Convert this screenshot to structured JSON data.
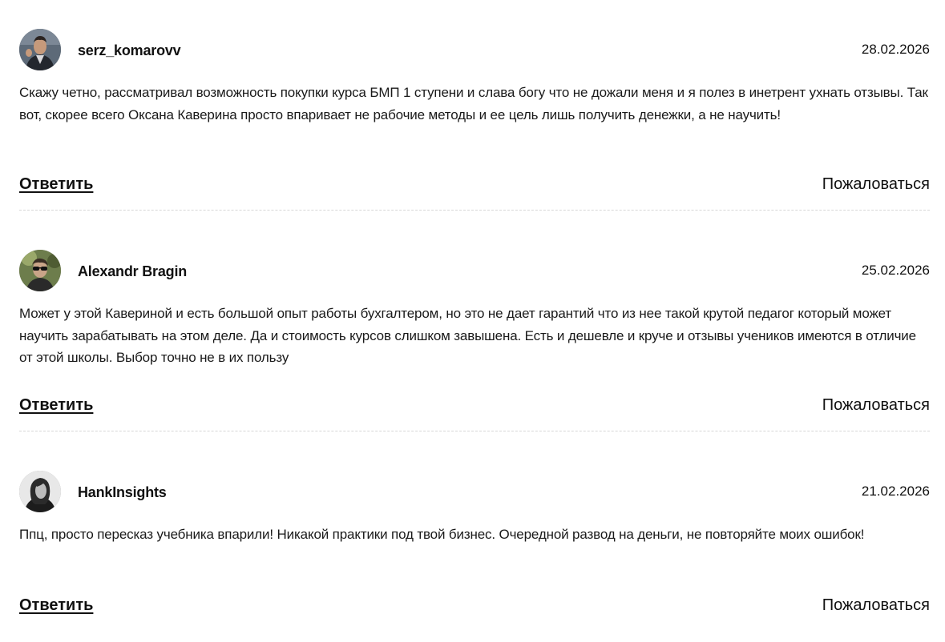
{
  "comments": [
    {
      "author": "serz_komarovv",
      "date": "28.02.2026",
      "text": "Скажу четно, рассматривал возможность покупки курса БМП 1 ступени и слава богу что не дожали меня и я полез в инетрент ухнать отзывы. Так вот, скорее всего Оксана Каверина просто впаривает не рабочие методы и ее цель лишь получить денежки, а не научить!",
      "reply_label": "Ответить",
      "report_label": "Пожаловаться",
      "avatar_icon": "user-avatar-photo"
    },
    {
      "author": "Alexandr Bragin",
      "date": "25.02.2026",
      "text": "Может у этой Кавериной и есть большой опыт работы бухгалтером, но это не дает гарантий что из нее такой крутой педагог который может научить зарабатывать на этом деле. Да и стоимость курсов слишком завышена. Есть и дешевле и круче и отзывы учеников имеются в отличие от этой школы. Выбор точно не в их пользу",
      "reply_label": "Ответить",
      "report_label": "Пожаловаться",
      "avatar_icon": "user-avatar-photo"
    },
    {
      "author": "HankInsights",
      "date": "21.02.2026",
      "text": "Ппц, просто пересказ учебника впарили! Никакой практики под твой бизнес. Очередной развод на деньги, не повторяйте моих ошибок!",
      "reply_label": "Ответить",
      "report_label": "Пожаловаться",
      "avatar_icon": "user-avatar-photo"
    }
  ],
  "colors": {
    "text": "#1a1a1a",
    "divider": "#d6d6d6",
    "background": "#ffffff"
  }
}
